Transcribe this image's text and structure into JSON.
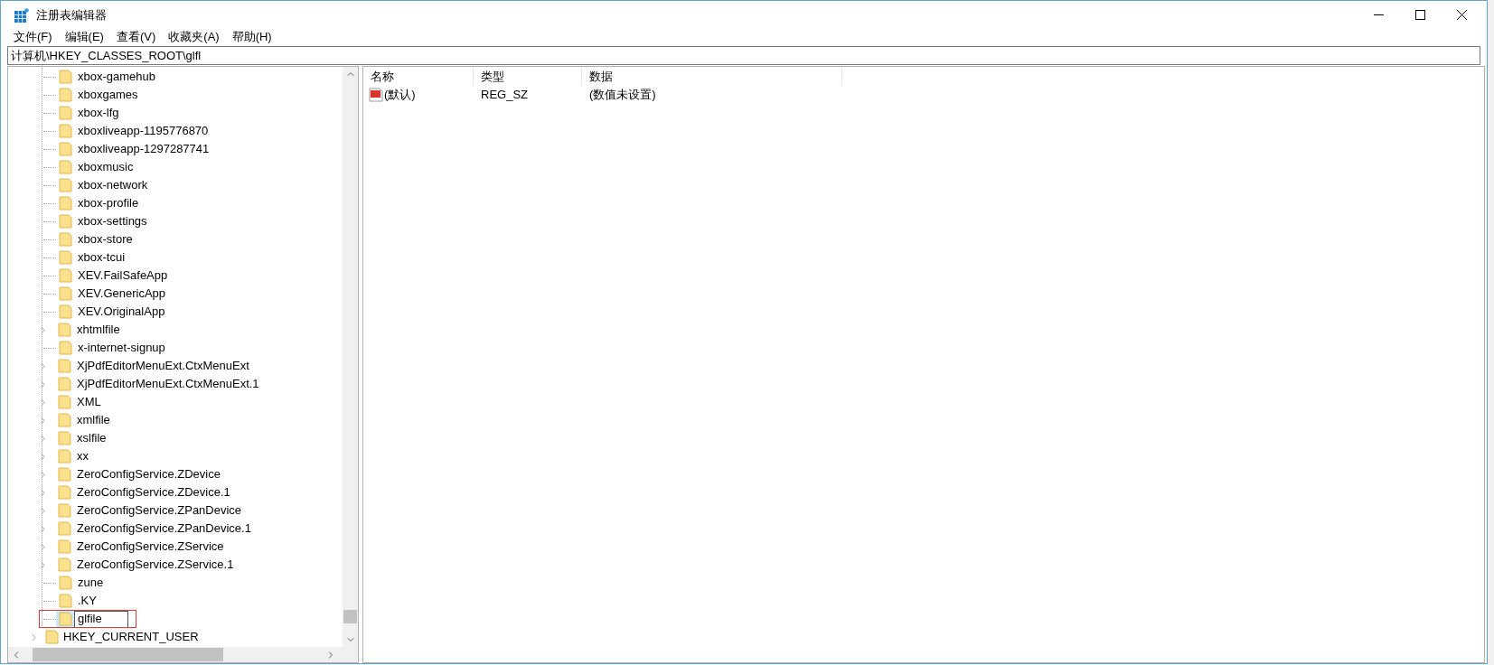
{
  "window": {
    "title": "注册表编辑器"
  },
  "menu": [
    "文件(F)",
    "编辑(E)",
    "查看(V)",
    "收藏夹(A)",
    "帮助(H)"
  ],
  "address_bar": {
    "value": "计算机\\HKEY_CLASSES_ROOT\\glfl"
  },
  "tree": {
    "items": [
      {
        "children": [
          {
            "label": "xbox-gamehub",
            "expandable": false,
            "selected": false,
            "editing": false,
            "annotated": false
          },
          {
            "label": "xboxgames",
            "expandable": false,
            "selected": false,
            "editing": false,
            "annotated": false
          },
          {
            "label": "xbox-lfg",
            "expandable": false,
            "selected": false,
            "editing": false,
            "annotated": false
          },
          {
            "label": "xboxliveapp-1195776870",
            "expandable": false,
            "selected": false,
            "editing": false,
            "annotated": false
          },
          {
            "label": "xboxliveapp-1297287741",
            "expandable": false,
            "selected": false,
            "editing": false,
            "annotated": false
          },
          {
            "label": "xboxmusic",
            "expandable": false,
            "selected": false,
            "editing": false,
            "annotated": false
          },
          {
            "label": "xbox-network",
            "expandable": false,
            "selected": false,
            "editing": false,
            "annotated": false
          },
          {
            "label": "xbox-profile",
            "expandable": false,
            "selected": false,
            "editing": false,
            "annotated": false
          },
          {
            "label": "xbox-settings",
            "expandable": false,
            "selected": false,
            "editing": false,
            "annotated": false
          },
          {
            "label": "xbox-store",
            "expandable": false,
            "selected": false,
            "editing": false,
            "annotated": false
          },
          {
            "label": "xbox-tcui",
            "expandable": false,
            "selected": false,
            "editing": false,
            "annotated": false
          },
          {
            "label": "XEV.FailSafeApp",
            "expandable": false,
            "selected": false,
            "editing": false,
            "annotated": false
          },
          {
            "label": "XEV.GenericApp",
            "expandable": false,
            "selected": false,
            "editing": false,
            "annotated": false
          },
          {
            "label": "XEV.OriginalApp",
            "expandable": false,
            "selected": false,
            "editing": false,
            "annotated": false
          },
          {
            "label": "xhtmlfile",
            "expandable": true,
            "selected": false,
            "editing": false,
            "annotated": false
          },
          {
            "label": "x-internet-signup",
            "expandable": false,
            "selected": false,
            "editing": false,
            "annotated": false
          },
          {
            "label": "XjPdfEditorMenuExt.CtxMenuExt",
            "expandable": true,
            "selected": false,
            "editing": false,
            "annotated": false
          },
          {
            "label": "XjPdfEditorMenuExt.CtxMenuExt.1",
            "expandable": true,
            "selected": false,
            "editing": false,
            "annotated": false
          },
          {
            "label": "XML",
            "expandable": true,
            "selected": false,
            "editing": false,
            "annotated": false
          },
          {
            "label": "xmlfile",
            "expandable": true,
            "selected": false,
            "editing": false,
            "annotated": false
          },
          {
            "label": "xslfile",
            "expandable": true,
            "selected": false,
            "editing": false,
            "annotated": false
          },
          {
            "label": "xx",
            "expandable": true,
            "selected": false,
            "editing": false,
            "annotated": false
          },
          {
            "label": "ZeroConfigService.ZDevice",
            "expandable": true,
            "selected": false,
            "editing": false,
            "annotated": false
          },
          {
            "label": "ZeroConfigService.ZDevice.1",
            "expandable": true,
            "selected": false,
            "editing": false,
            "annotated": false
          },
          {
            "label": "ZeroConfigService.ZPanDevice",
            "expandable": true,
            "selected": false,
            "editing": false,
            "annotated": false
          },
          {
            "label": "ZeroConfigService.ZPanDevice.1",
            "expandable": true,
            "selected": false,
            "editing": false,
            "annotated": false
          },
          {
            "label": "ZeroConfigService.ZService",
            "expandable": true,
            "selected": false,
            "editing": false,
            "annotated": false
          },
          {
            "label": "ZeroConfigService.ZService.1",
            "expandable": true,
            "selected": false,
            "editing": false,
            "annotated": false
          },
          {
            "label": "zune",
            "expandable": false,
            "selected": false,
            "editing": false,
            "annotated": false
          },
          {
            "label": ".KY",
            "expandable": false,
            "selected": false,
            "editing": false,
            "annotated": false
          },
          {
            "label": "glfile",
            "expandable": false,
            "selected": true,
            "editing": true,
            "annotated": true
          }
        ]
      },
      {
        "label": "HKEY_CURRENT_USER",
        "expandable": true,
        "selected": false
      }
    ]
  },
  "values_table": {
    "columns": [
      "名称",
      "类型",
      "数据"
    ],
    "rows": [
      {
        "name": "(默认)",
        "type": "REG_SZ",
        "data": "(数值未设置)"
      }
    ]
  }
}
